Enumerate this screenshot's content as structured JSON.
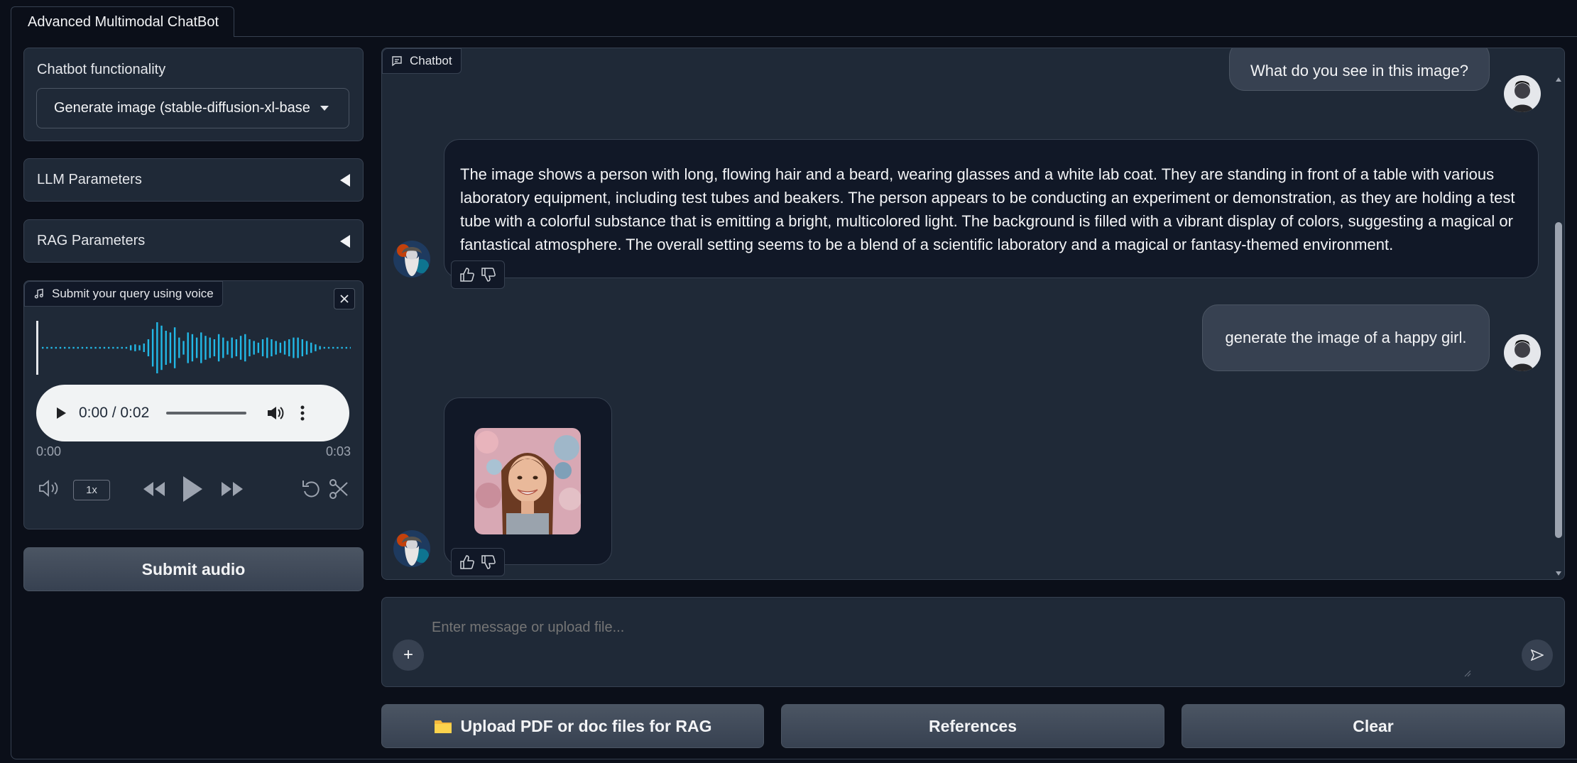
{
  "tab": {
    "label": "Advanced Multimodal ChatBot"
  },
  "sidebar": {
    "functionality": {
      "label": "Chatbot functionality",
      "selected": "Generate image (stable-diffusion-xl-base"
    },
    "llm_params": {
      "label": "LLM Parameters"
    },
    "rag_params": {
      "label": "RAG Parameters"
    },
    "voice": {
      "label": "Submit your query using voice",
      "player_time": "0:00 / 0:02",
      "start_time": "0:00",
      "end_time": "0:03",
      "speed": "1x",
      "playback_progress": 0
    },
    "submit_audio": "Submit audio"
  },
  "chat": {
    "label": "Chatbot",
    "messages": [
      {
        "role": "user",
        "text": "What do you see in this image?"
      },
      {
        "role": "bot",
        "text": "The image shows a person with long, flowing hair and a beard, wearing glasses and a white lab coat. They are standing in front of a table with various laboratory equipment, including test tubes and beakers. The person appears to be conducting an experiment or demonstration, as they are holding a test tube with a colorful substance that is emitting a bright, multicolored light. The background is filled with a vibrant display of colors, suggesting a magical or fantastical atmosphere. The overall setting seems to be a blend of a scientific laboratory and a magical or fantasy-themed environment."
      },
      {
        "role": "user",
        "text": "generate the image of a happy girl."
      },
      {
        "role": "bot",
        "image": "generated-portrait"
      }
    ]
  },
  "input": {
    "placeholder": "Enter message or upload file..."
  },
  "actions": {
    "upload": "Upload PDF or doc files for RAG",
    "references": "References",
    "clear": "Clear"
  },
  "colors": {
    "accent_wave": "#22b8e6",
    "background": "#0b0f19",
    "panel": "#1f2937"
  }
}
